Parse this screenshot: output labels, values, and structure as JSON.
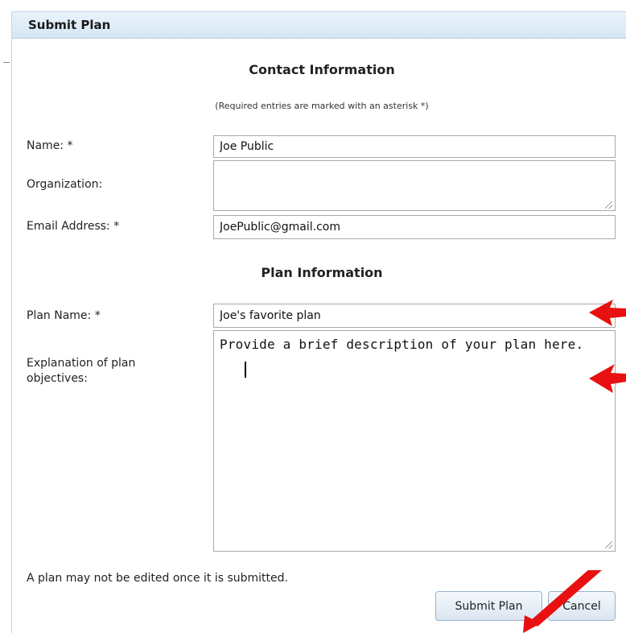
{
  "dialog": {
    "title": "Submit Plan"
  },
  "contact": {
    "heading": "Contact Information",
    "note": "(Required entries are marked with an asterisk *)",
    "name_label": "Name: *",
    "name_value": "Joe Public",
    "org_label": "Organization:",
    "org_value": "",
    "email_label": "Email Address: *",
    "email_value": "JoePublic@gmail.com"
  },
  "plan": {
    "heading": "Plan Information",
    "name_label": "Plan Name: *",
    "name_value": "Joe's favorite plan",
    "objectives_label": "Explanation of plan objectives:",
    "objectives_value": "Provide a brief description of your plan here."
  },
  "footer": {
    "note": "A plan may not be edited once it is submitted.",
    "submit_label": "Submit Plan",
    "cancel_label": "Cancel"
  },
  "annotations": {
    "arrow_color": "#e81010"
  }
}
